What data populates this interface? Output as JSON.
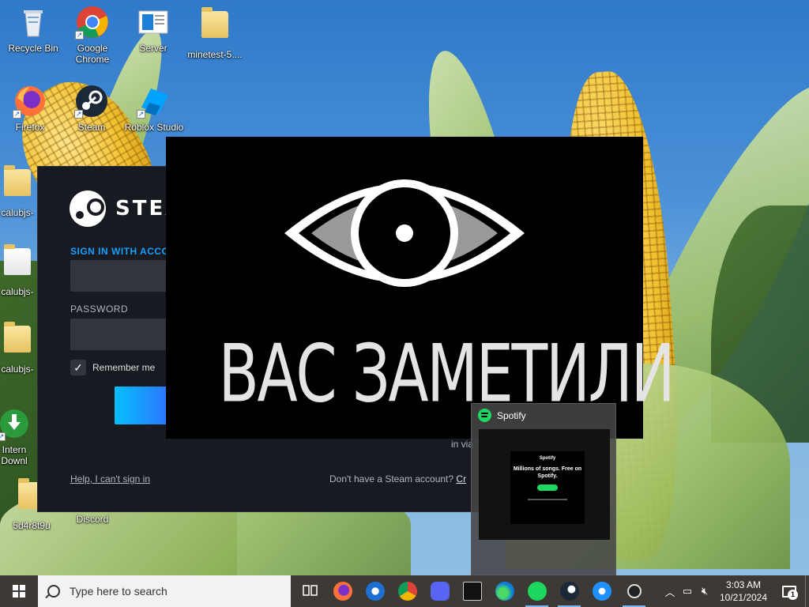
{
  "desktop": {
    "icons": [
      {
        "label": "Recycle Bin",
        "icon": "recycle-bin-icon"
      },
      {
        "label": "Google Chrome",
        "icon": "chrome-icon"
      },
      {
        "label": "Server",
        "icon": "server-icon"
      },
      {
        "label": "minetest-5....",
        "icon": "folder-icon"
      },
      {
        "label": "Firefox",
        "icon": "firefox-icon"
      },
      {
        "label": "Steam",
        "icon": "steam-icon"
      },
      {
        "label": "Roblox Studio",
        "icon": "roblox-studio-icon"
      },
      {
        "label": "calubjs-",
        "icon": "folder-icon"
      },
      {
        "label": "calubjs-",
        "icon": "file-icon"
      },
      {
        "label": "calubjs-",
        "icon": "folder-icon"
      },
      {
        "label": "Intern Downl",
        "icon": "internet-download-manager-icon"
      },
      {
        "label": "5d4r8t9u",
        "icon": "folder-icon"
      },
      {
        "label": "Discord",
        "icon": "discord-icon"
      }
    ]
  },
  "steam_login": {
    "logo_text": "STEA",
    "sign_in_label": "SIGN IN WITH ACCOU",
    "password_label": "PASSWORD",
    "remember_label": "Remember me",
    "remember_checked": "✓",
    "help_link": "Help, I can't sign in",
    "no_account_text": "Don't have a Steam account?",
    "create_link": "Cr",
    "qr_hint": "in via"
  },
  "overlay": {
    "text": "ВАС ЗАМЕТИЛИ"
  },
  "spotify_preview": {
    "title": "Spotify",
    "card_brand": "Spotify",
    "card_message": "Millions of songs. Free on Spotify."
  },
  "taskbar": {
    "search_placeholder": "Type here to search",
    "apps": [
      "task-view-icon",
      "firefox-icon",
      "thunderbird-icon",
      "chrome-icon",
      "discord-icon",
      "terminal-icon",
      "edge-icon",
      "spotify-icon",
      "steam-icon",
      "internet-explorer-icon",
      "unity-icon"
    ],
    "time": "3:03 AM",
    "date": "10/21/2024",
    "notification_count": "1"
  },
  "colors": {
    "steam_bg": "#181a21",
    "steam_accent": "#1a9fff",
    "spotify_green": "#1ed760",
    "taskbar_bg": "#28231e"
  }
}
